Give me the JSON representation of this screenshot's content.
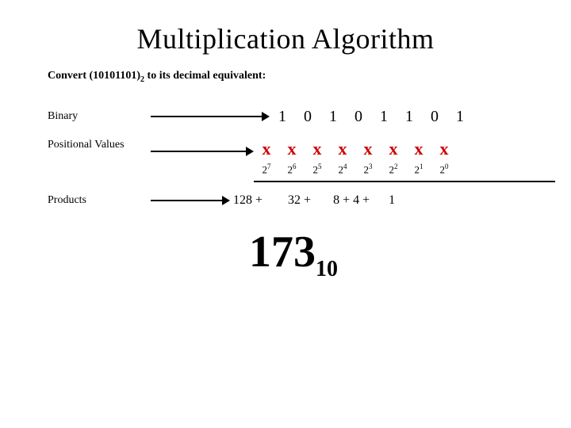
{
  "title": "Multiplication Algorithm",
  "subtitle": {
    "text": "Convert (10101101)",
    "subscript": "2",
    "rest": " to its decimal equivalent:"
  },
  "binary_label": "Binary",
  "binary_digits": [
    "1",
    "0",
    "1",
    "0",
    "1",
    "1",
    "0",
    "1"
  ],
  "positional_label": "Positional Values",
  "x_marks": [
    "x",
    "x",
    "x",
    "x",
    "x",
    "x",
    "x",
    "x"
  ],
  "positional_values": [
    {
      "base": "2",
      "exp": "7"
    },
    {
      "base": "2",
      "exp": "6"
    },
    {
      "base": "2",
      "exp": "5"
    },
    {
      "base": "2",
      "exp": "4"
    },
    {
      "base": "2",
      "exp": "3"
    },
    {
      "base": "2",
      "exp": "2"
    },
    {
      "base": "2",
      "exp": "1"
    },
    {
      "base": "2",
      "exp": "0"
    }
  ],
  "products_label": "Products",
  "products_values": "128 +        32 +        8 + 4 +          1",
  "products_parts": [
    "128 +",
    "32 +",
    "8 + 4 +",
    "1"
  ],
  "result": {
    "number": "173",
    "subscript": "10"
  },
  "colors": {
    "x_color": "#cc0000",
    "arrow_color": "#000000",
    "text_color": "#000000"
  }
}
